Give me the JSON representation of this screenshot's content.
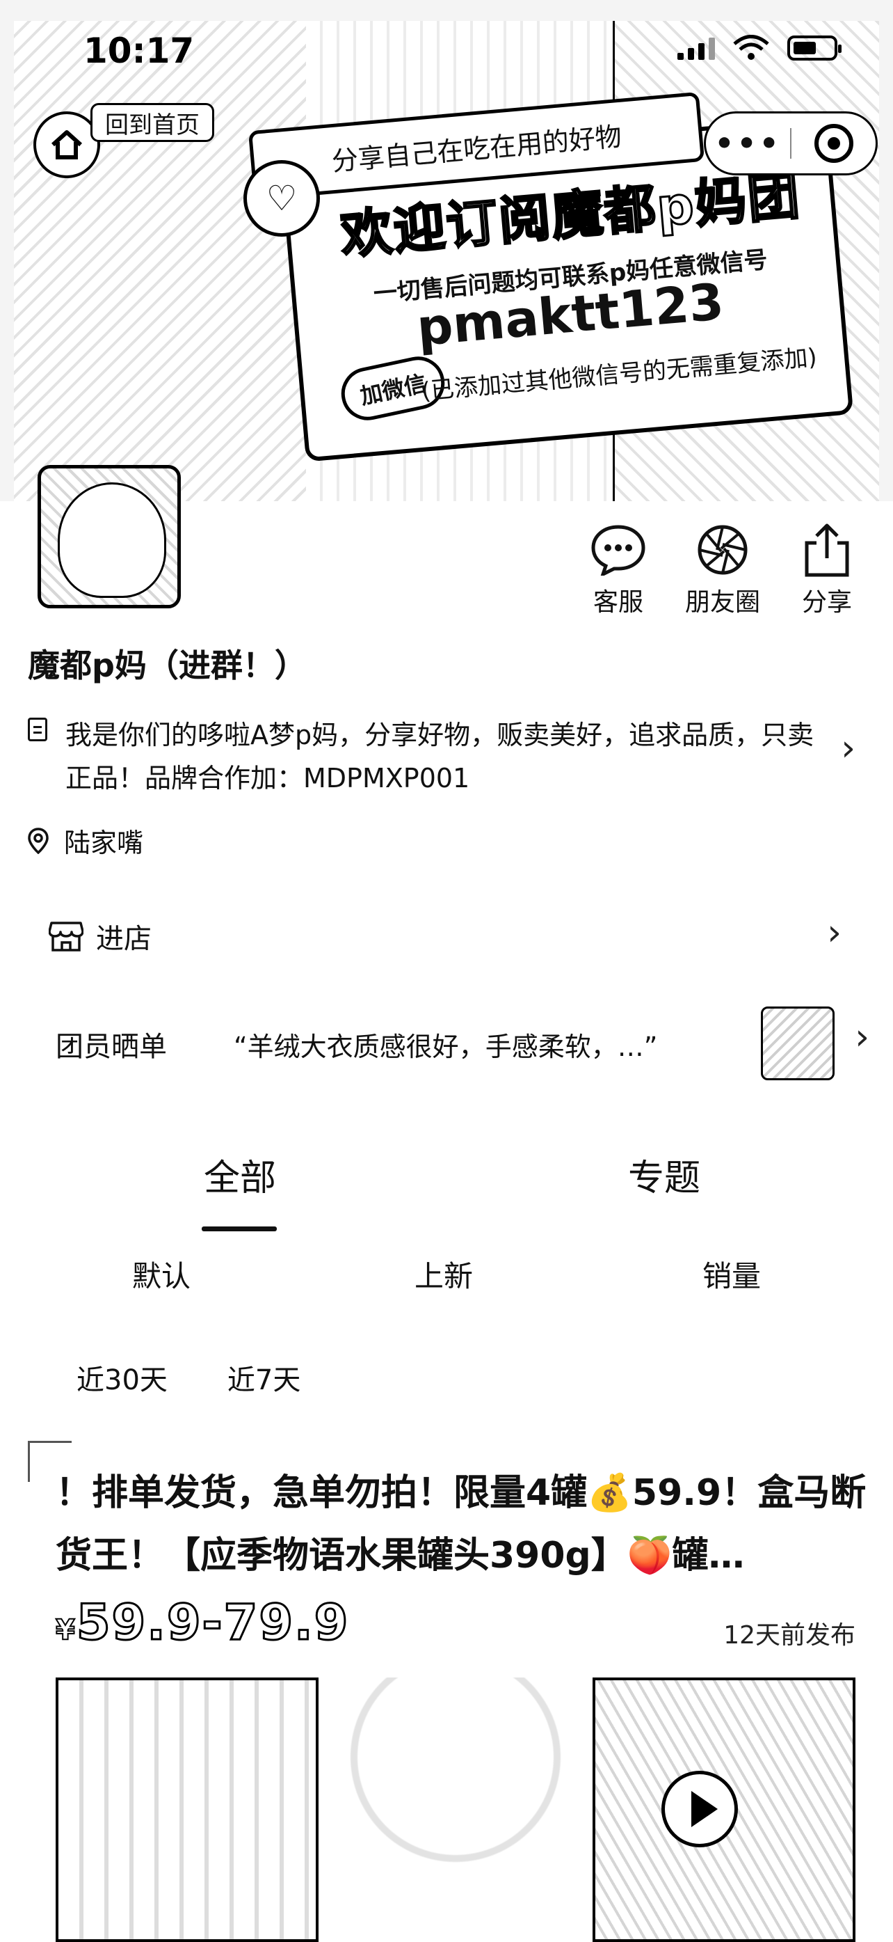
{
  "status_bar": {
    "time": "10:17"
  },
  "nav": {
    "home_label": "回到首页"
  },
  "banner": {
    "top_text": "分享自己在吃在用的好物",
    "title": "欢迎订阅魔都p妈团",
    "subtitle": "一切售后问题均可联系p妈任意微信号",
    "wechat_id": "pmaktt123",
    "add_button": "加微信",
    "note": "(已添加过其他微信号的无需重复添加)"
  },
  "actions": [
    {
      "label": "客服",
      "icon": "chat-bubble-icon"
    },
    {
      "label": "朋友圈",
      "icon": "moments-shutter-icon"
    },
    {
      "label": "分享",
      "icon": "share-icon"
    }
  ],
  "shop": {
    "name": "魔都p妈（进群！）",
    "description": "我是你们的哆啦A梦p妈，分享好物，贩卖美好，追求品质，只卖正品！品牌合作加：MDPMXP001",
    "location": "陆家嘴"
  },
  "enter_store": {
    "label": "进店"
  },
  "reviews": {
    "label": "团员晒单",
    "quote": "“羊绒大衣质感很好，手感柔软，…”"
  },
  "tabs": [
    {
      "label": "全部",
      "active": true
    },
    {
      "label": "专题",
      "active": false
    }
  ],
  "sorts": [
    "默认",
    "上新",
    "销量"
  ],
  "ranges": [
    "近30天",
    "近7天"
  ],
  "product": {
    "title": "！排单发货，急单勿拍！限量4罐💰59.9！盒马断货王！【应季物语水果罐头390g】🍑罐…",
    "currency": "¥",
    "price": "59.9-79.9",
    "posted": "12天前发布"
  }
}
